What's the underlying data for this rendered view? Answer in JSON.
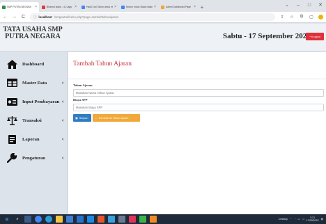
{
  "browser": {
    "tabs": [
      {
        "title": "SMP PUTRA NEGARA",
        "color": "#2f8c4a",
        "active": true
      },
      {
        "title": "Bhanna Isana - 41 Lagu",
        "color": "#e53935",
        "active": false
      },
      {
        "title": "Hasil Cari Tahun untuk nis",
        "color": "#4285f4",
        "active": false
      },
      {
        "title": "Nomor Induk Siswa Nasional",
        "color": "#4285f4",
        "active": false
      },
      {
        "title": "Admin Dashboard Page",
        "color": "#f2a42f",
        "active": false
      }
    ],
    "new_tab": "+",
    "window_controls": [
      "⌄",
      "–",
      "□",
      "✕"
    ],
    "address": {
      "host": "localhost",
      "path": "/smpputra/index.php?page=tambahtahunajaran"
    }
  },
  "header": {
    "brand_line1": "TATA USAHA SMP",
    "brand_line2": "PUTRA NEGARA",
    "date": "Sabtu - 17 September 2022",
    "logout_label": "Logout"
  },
  "sidebar": {
    "items": [
      {
        "label": "Dashboard",
        "icon": "home-icon",
        "has_submenu": false
      },
      {
        "label": "Master Data",
        "icon": "table-icon",
        "has_submenu": true
      },
      {
        "label": "Input Pembayaran",
        "icon": "money-icon",
        "has_submenu": true
      },
      {
        "label": "Transaksi",
        "icon": "balance-scale-icon",
        "has_submenu": true
      },
      {
        "label": "Laporan",
        "icon": "report-icon",
        "has_submenu": true
      },
      {
        "label": "Pengaturan",
        "icon": "wrench-icon",
        "has_submenu": true
      }
    ]
  },
  "main": {
    "title": "Tambah Tahun Ajaran",
    "fields": [
      {
        "label": "Tahun Ajaran",
        "placeholder": "Masukan Nama Tahun Ajaran"
      },
      {
        "label": "Biaya SPP",
        "placeholder": "Masukan Biaya SPP"
      }
    ],
    "save_label": "Simpan",
    "back_label": "Kembali Ke Tahun Ajaran"
  },
  "taskbar": {
    "tray_label": "Desktop",
    "time": "3:21",
    "date": "17/09/2022"
  },
  "colors": {
    "accent_red": "#c8323c",
    "logout_red": "#e0303a",
    "save_blue": "#2e7dc2",
    "back_orange": "#f0a93a",
    "sidebar_bg": "#dde3ea",
    "taskbar_bg": "#1f2a3a"
  }
}
